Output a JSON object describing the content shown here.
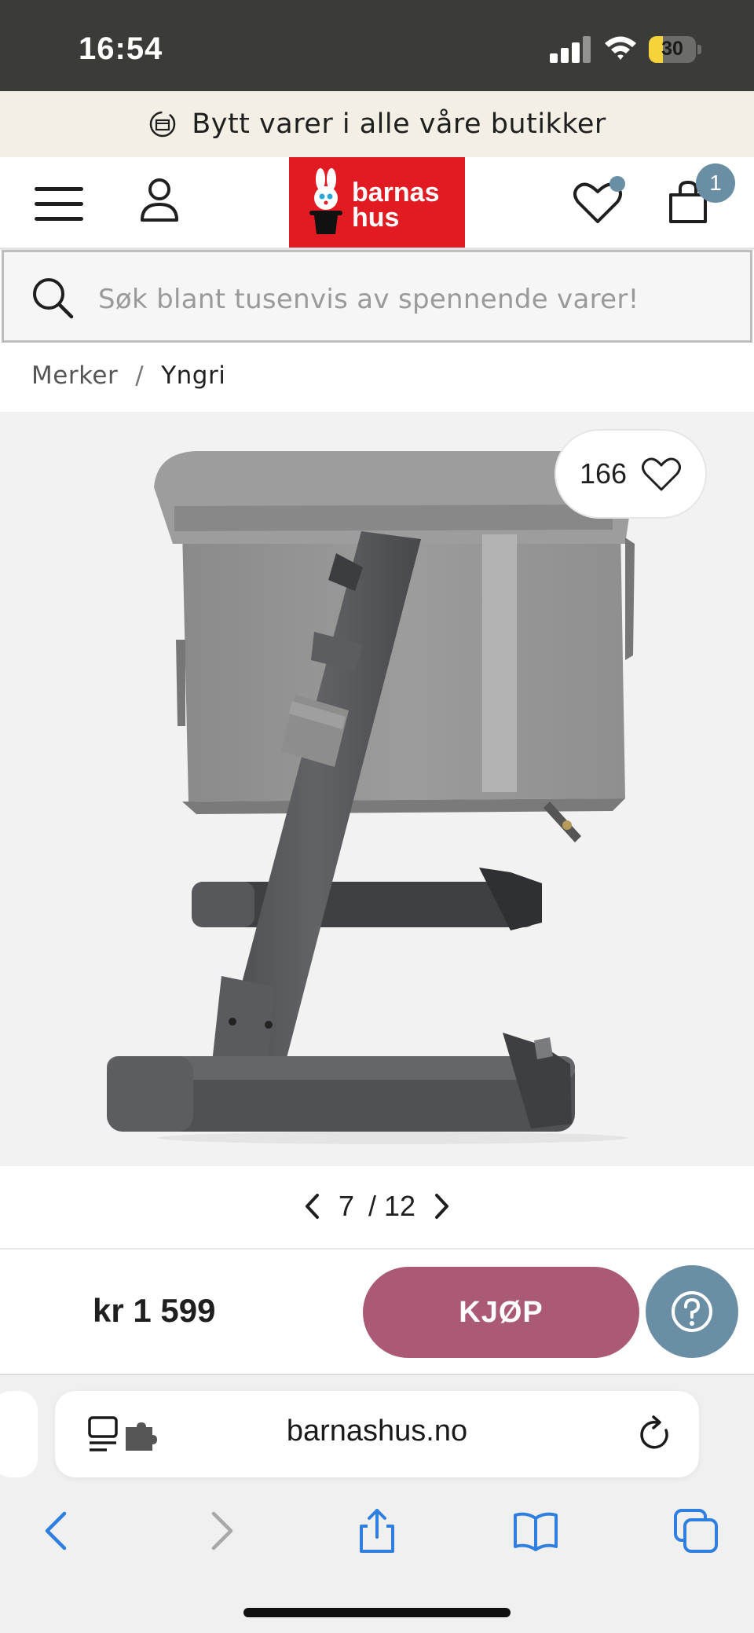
{
  "status_bar": {
    "time": "16:54",
    "battery_text": "30",
    "battery_level": 0.3,
    "icons": [
      "signal-icon",
      "wifi-icon",
      "battery-icon"
    ]
  },
  "promo": {
    "text": "Bytt varer i alle våre butikker",
    "icon": "exchange-icon"
  },
  "header": {
    "menu_icon": "hamburger-menu-icon",
    "account_icon": "user-icon",
    "logo_line1": "barnas",
    "logo_line2": "hus",
    "wishlist_icon": "heart-icon",
    "cart_icon": "shopping-bag-icon",
    "cart_count": "1",
    "brand_color": "#e11b21",
    "accent_color": "#6a8fa4"
  },
  "search": {
    "placeholder": "Søk blant tusenvis av spennende varer!",
    "icon": "search-icon"
  },
  "breadcrumb": {
    "items": [
      "Merker",
      "Yngri"
    ],
    "separator": "/"
  },
  "product": {
    "image_description_icon": "bedside-crib-image",
    "likes": "166",
    "image_index": "7",
    "image_total": "/ 12"
  },
  "buy": {
    "price": "kr 1 599",
    "button_label": "KJØP",
    "button_color": "#ab5a75",
    "help_icon": "question-icon"
  },
  "browser": {
    "domain": "barnashus.no",
    "toolbar": [
      "back-icon",
      "forward-icon",
      "share-icon",
      "bookmarks-icon",
      "tabs-icon"
    ],
    "link_color": "#2f7fe0"
  }
}
